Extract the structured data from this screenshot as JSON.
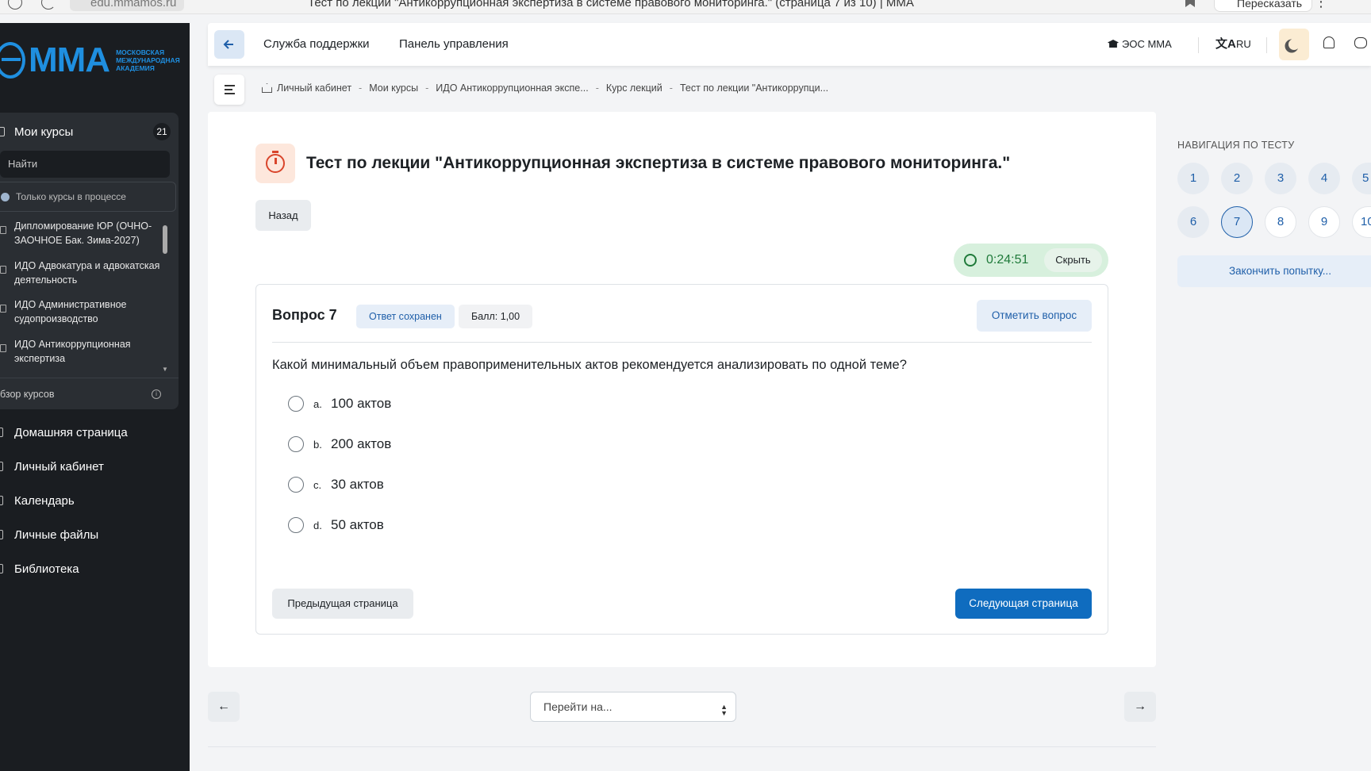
{
  "browser": {
    "url": "edu.mmamos.ru",
    "tab_title": "Тест по лекции \"Антикоррупционная экспертиза в системе правового мониторинга.\" (страница 7 из 10) | ММА",
    "retell_label": "Пересказать"
  },
  "sidebar": {
    "logo_text": "ММА",
    "logo_sub": "МОСКОВСКАЯ МЕЖДУНАРОДНАЯ АКАДЕМИЯ",
    "courses_title": "Мои курсы",
    "courses_count": "21",
    "search_placeholder": "Найти",
    "filter_label": "Только курсы в процессе",
    "courses": [
      "Дипломирование ЮР (ОЧНО-ЗАОЧНОЕ Бак. Зима-2027)",
      "ИДО Адвокатура и адвокатская деятельность",
      "ИДО Административное судопроизводство",
      "ИДО Антикоррупционная экспертиза"
    ],
    "overview_label": "бзор курсов",
    "nav": [
      "Домашняя страница",
      "Личный кабинет",
      "Календарь",
      "Личные файлы",
      "Библиотека"
    ]
  },
  "topbar": {
    "support": "Служба поддержки",
    "dashboard": "Панель управления",
    "eos": "ЭОС ММА",
    "lang": "RU",
    "lang_icon": "文A"
  },
  "breadcrumb": [
    "Личный кабинет",
    "Мои курсы",
    "ИДО Антикоррупционная экспе...",
    "Курс лекций",
    "Тест по лекции \"Антикоррупци..."
  ],
  "quiz": {
    "title": "Тест по лекции \"Антикоррупционная экспертиза в системе правового мониторинга.\"",
    "back_label": "Назад",
    "timer_value": "0:24:51",
    "timer_hide": "Скрыть",
    "question_label": "Вопрос 7",
    "status": "Ответ сохранен",
    "score": "Балл: 1,00",
    "flag_label": "Отметить вопрос",
    "question_text": "Какой минимальный объем правоприменительных актов рекомендуется анализировать по одной теме?",
    "options": [
      {
        "letter": "a.",
        "text": "100 актов"
      },
      {
        "letter": "b.",
        "text": "200 актов"
      },
      {
        "letter": "c.",
        "text": "30 актов"
      },
      {
        "letter": "d.",
        "text": "50 актов"
      }
    ],
    "prev_page": "Предыдущая страница",
    "next_page": "Следующая страница"
  },
  "quiz_nav": {
    "title": "НАВИГАЦИЯ ПО ТЕСТУ",
    "buttons": [
      "1",
      "2",
      "3",
      "4",
      "5",
      "6",
      "7",
      "8",
      "9",
      "10"
    ],
    "current": "7",
    "finish_label": "Закончить попытку..."
  },
  "bottom_nav": {
    "prev_arrow": "←",
    "next_arrow": "→",
    "jump_label": "Перейти на..."
  },
  "colors": {
    "primary": "#0f6cbf",
    "sidebar_bg": "#1a1d21",
    "logo": "#1f8fe0",
    "timer_bg": "#d7f0dd",
    "alert_icon": "#d9452b"
  }
}
